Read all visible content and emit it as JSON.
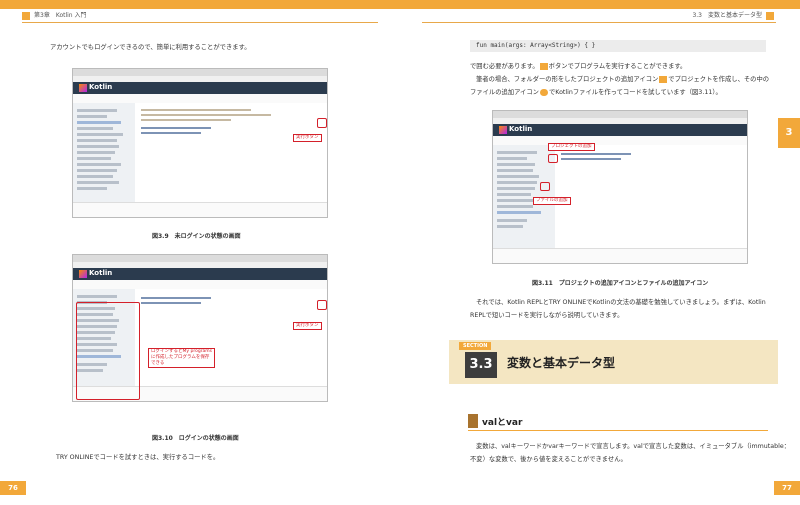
{
  "left": {
    "header": "第3章　Kotlin 入門",
    "intro": "アカウントでもログインできるので、簡単に利用することができます。",
    "fig1": {
      "caption": "図3.9　未ログインの状態の画面",
      "callout": "実行ボタン",
      "logo": "Kotlin"
    },
    "fig2": {
      "caption": "図3.10　ログインの状態の画面",
      "callout_run": "実行ボタン",
      "callout_login": "ログインするとMy programs\nに作成したプログラムを保存\nできる",
      "logo": "Kotlin"
    },
    "footer_text": "TRY ONLINEでコードを試すときは、実行するコードを。",
    "page_number": "76"
  },
  "right": {
    "header": "3.3　変数と基本データ型",
    "code": "fun main(args: Array<String>) { }",
    "para1_line1": "で囲む必要があります。",
    "para1_line1b": "ボタンでプログラムを実行することができます。",
    "para2_line1a": "筆者の場合、フォルダーの形をしたプロジェクトの追加アイコン",
    "para2_line1b": "でプロジェクトを作成し、その中の",
    "para2_line2a": "ファイルの追加アイコン",
    "para2_line2b": "でKotlinファイルを作ってコードを試しています（図3.11）。",
    "fig3": {
      "caption": "図3.11　プロジェクトの追加アイコンとファイルの追加アイコン",
      "callout_project": "プロジェクトの追加",
      "callout_file": "ファイルの追加",
      "logo": "Kotlin"
    },
    "para3_line1": "それでは、Kotlin REPLとTRY ONLINEでKotlinの文法の基礎を勉強していきましょう。まずは、Kotlin",
    "para3_line2": "REPLで短いコードを実行しながら説明していきます。",
    "section": {
      "label": "SECTION",
      "number": "3.3",
      "title": "変数と基本データ型"
    },
    "subhead": "valとvar",
    "para4_line1": "変数は、valキーワードかvarキーワードで宣言します。valで宣言した変数は、イミュータブル（immutable：",
    "para4_line2": "不変）な変数で、後から値を変えることができません。",
    "side_tab": "3",
    "page_number": "77"
  },
  "colors": {
    "accent": "#f2a83a",
    "callout": "#d4202a",
    "section_bg": "#f4e6c2"
  }
}
